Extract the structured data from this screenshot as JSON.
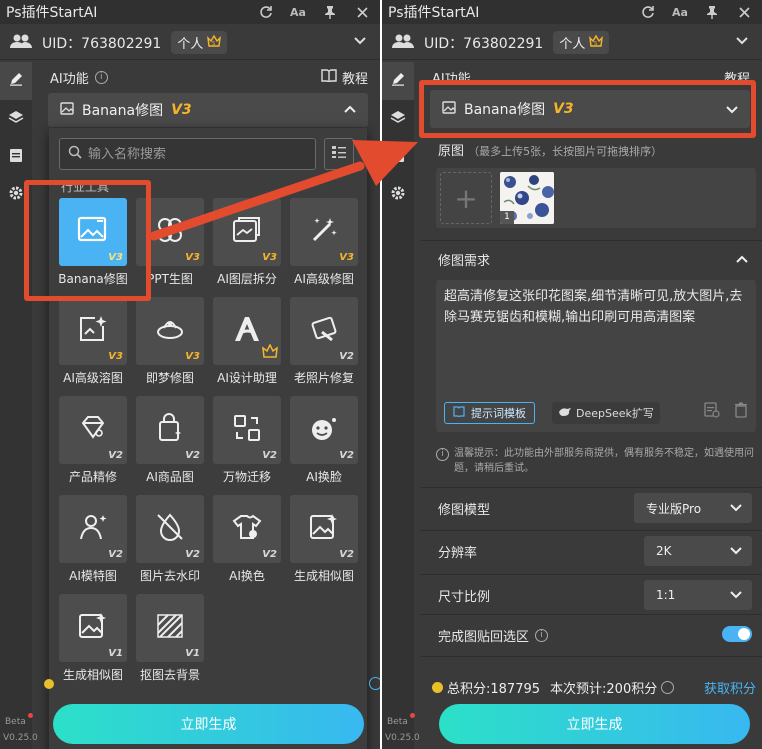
{
  "app_title": "Ps插件StartAI",
  "uid": {
    "label": "UID：763802291",
    "plan": "个人"
  },
  "section": {
    "title": "AI功能",
    "tutorial": "教程"
  },
  "model_select": {
    "label": "Banana修图",
    "version": "V3"
  },
  "search": {
    "placeholder": "输入名称搜索"
  },
  "group_label": "行业工具",
  "tools": [
    {
      "label": "Banana修图",
      "version": "V3",
      "icon": "image-edit-icon"
    },
    {
      "label": "PPT生图",
      "version": "V3",
      "icon": "ppt-icon"
    },
    {
      "label": "AI图层拆分",
      "version": "V3",
      "icon": "layer-split-icon"
    },
    {
      "label": "AI高级修图",
      "version": "V3",
      "icon": "magic-wand-icon"
    },
    {
      "label": "AI高级溶图",
      "version": "V3",
      "icon": "image-sparkle-icon"
    },
    {
      "label": "即梦修图",
      "version": "",
      "icon": "dream-edit-icon"
    },
    {
      "label": "AI设计助理",
      "version": "",
      "icon": "design-assistant-icon"
    },
    {
      "label": "老照片修复",
      "version": "V2",
      "icon": "photo-restore-icon"
    },
    {
      "label": "产品精修",
      "version": "V2",
      "icon": "diamond-icon"
    },
    {
      "label": "AI商品图",
      "version": "V2",
      "icon": "shopping-bag-icon"
    },
    {
      "label": "万物迁移",
      "version": "V2",
      "icon": "transfer-icon"
    },
    {
      "label": "AI换脸",
      "version": "V2",
      "icon": "face-swap-icon"
    },
    {
      "label": "AI模特图",
      "version": "V2",
      "icon": "model-person-icon"
    },
    {
      "label": "图片去水印",
      "version": "V2",
      "icon": "watermark-remove-icon"
    },
    {
      "label": "AI换色",
      "version": "V2",
      "icon": "tshirt-color-icon"
    },
    {
      "label": "生成相似图",
      "version": "V2",
      "icon": "similar-image-icon"
    },
    {
      "label": "生成相似图",
      "version": "V1",
      "icon": "similar-image-icon"
    },
    {
      "label": "抠图去背景",
      "version": "V1",
      "icon": "cutout-icon"
    }
  ],
  "original_image": {
    "title": "原图",
    "note": "（最多上传5张，长按图片可拖拽排序）",
    "thumb_index": "1"
  },
  "requirement": {
    "title": "修图需求",
    "text": "超高清修复这张印花图案,细节清晰可见,放大图片,去除马赛克锯齿和模糊,输出印刷可用高清图案",
    "template_button": "提示词模板",
    "deepseek_button": "DeepSeek扩写"
  },
  "tip": "温馨提示：此功能由外部服务商提供，偶有服务不稳定，如遇使用问题，请稍后重试。",
  "settings": {
    "model_label": "修图模型",
    "model_value": "专业版Pro",
    "resolution_label": "分辨率",
    "resolution_value": "2K",
    "ratio_label": "尺寸比例",
    "ratio_value": "1:1",
    "paste_label": "完成图贴回选区",
    "paste_on": true
  },
  "credits": {
    "total": "总积分:187795",
    "estimate": "本次预计:200积分",
    "get": "获取积分"
  },
  "generate_button": "立即生成",
  "beta": "Beta",
  "version": "V0.25.0",
  "colors": {
    "accent": "#4ab3f4",
    "gold": "#f5b52b",
    "highlight": "#e24b2d",
    "panel": "#3a3a3a"
  }
}
